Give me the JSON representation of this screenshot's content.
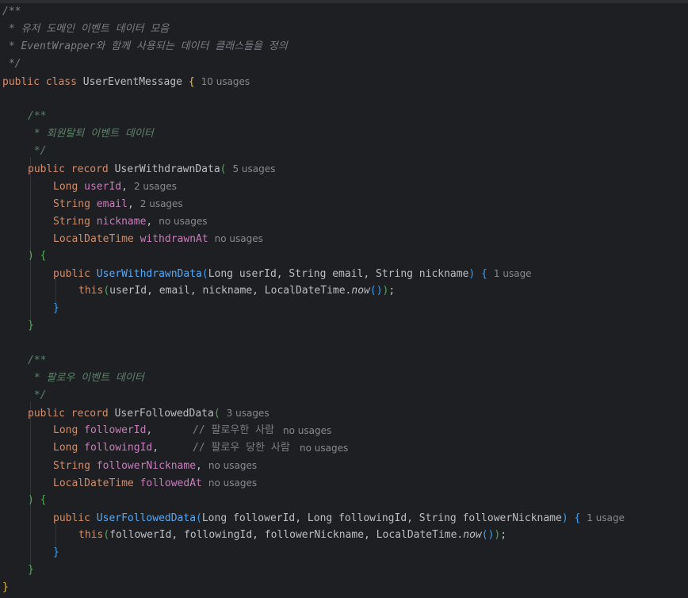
{
  "doc": {
    "open": "/**",
    "line1": " * 유저 도메인 이벤트 데이터 모음",
    "line2": " * EventWrapper와 함께 사용되는 데이터 클래스들을 정의",
    "close": " */"
  },
  "cls": {
    "kw": "public class",
    "name": "UserEventMessage",
    "brace": "{",
    "hint": "10 usages",
    "end_brace": "}"
  },
  "kw": {
    "public": "public",
    "record": "record",
    "this": "this",
    "long": "Long",
    "string": "String",
    "ldt": "LocalDateTime"
  },
  "p": {
    "comma": ",",
    "lparen": "(",
    "rparen": ")",
    "lbrace": "{",
    "rbrace": "}",
    "semi": ";",
    "dot": ".",
    "sp": " "
  },
  "withdrawn": {
    "doc_open": "/**",
    "doc_text": " * 회원탈퇴 이벤트 데이터",
    "doc_close": " */",
    "name": "UserWithdrawnData",
    "hint": "5 usages",
    "fields": [
      {
        "name": "userId",
        "hint": "2 usages"
      },
      {
        "name": "email",
        "hint": "2 usages"
      },
      {
        "name": "nickname",
        "hint": "no usages"
      },
      {
        "name": "withdrawnAt",
        "hint": "no usages"
      }
    ],
    "ctor_params": "Long userId, String email, String nickname",
    "ctor_hint": "1 usage",
    "this_args": "userId, email, nickname, LocalDateTime.",
    "now": "now",
    "call_parens": "()"
  },
  "followed": {
    "doc_open": "/**",
    "doc_text": " * 팔로우 이벤트 데이터",
    "doc_close": " */",
    "name": "UserFollowedData",
    "hint": "3 usages",
    "fields": [
      {
        "name": "followerId",
        "comment": "// 팔로우한 사람",
        "hint": "no usages"
      },
      {
        "name": "followingId",
        "comment": "// 팔로우 당한 사람",
        "hint": "no usages"
      },
      {
        "name": "followerNickname",
        "hint": "no usages"
      },
      {
        "name": "followedAt",
        "hint": "no usages"
      }
    ],
    "ctor_params": "Long followerId, Long followingId, String followerNickname",
    "ctor_hint": "1 usage",
    "this_args": "followerId, followingId, followerNickname, LocalDateTime.",
    "now": "now",
    "call_parens": "()"
  }
}
